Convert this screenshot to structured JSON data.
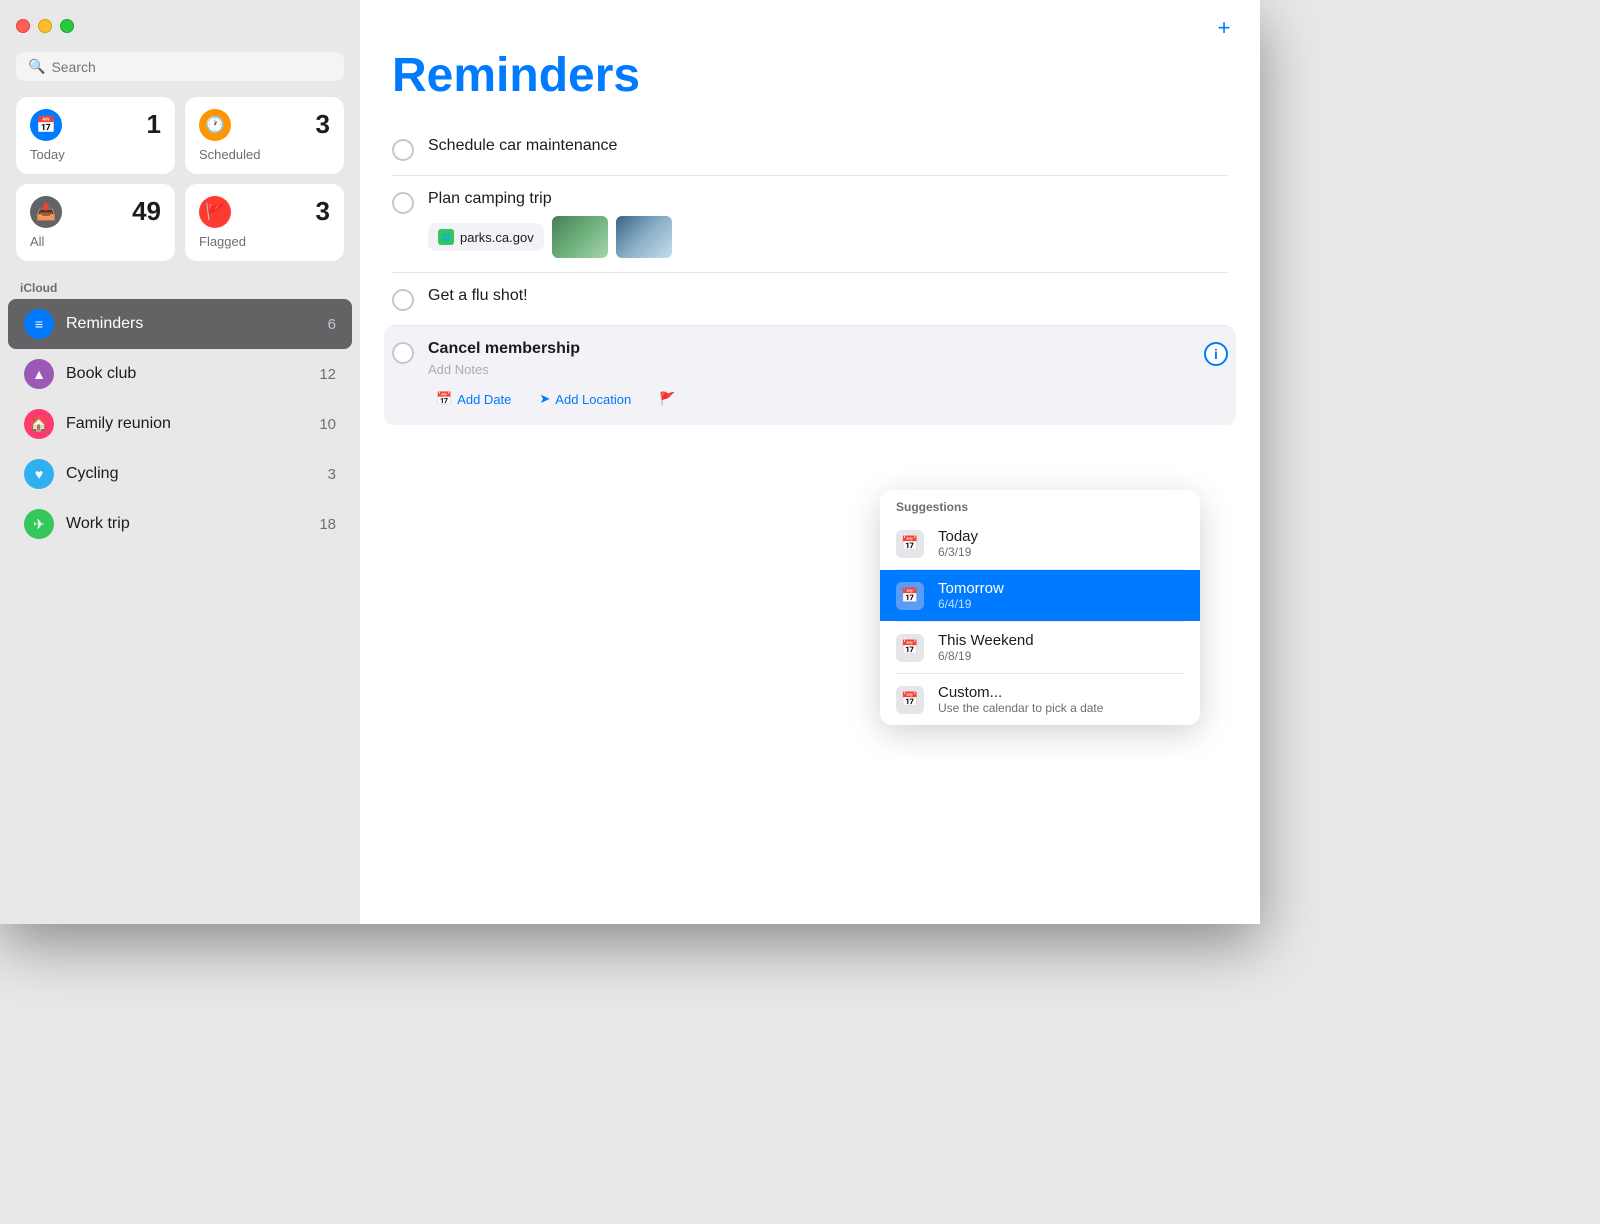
{
  "titlebar": {
    "traffic_lights": [
      "red",
      "yellow",
      "green"
    ]
  },
  "search": {
    "placeholder": "Search"
  },
  "smart_lists": [
    {
      "id": "today",
      "label": "Today",
      "count": "1",
      "icon_color": "#007aff",
      "icon": "📅"
    },
    {
      "id": "scheduled",
      "label": "Scheduled",
      "count": "3",
      "icon_color": "#ff9500",
      "icon": "🕐"
    },
    {
      "id": "all",
      "label": "All",
      "count": "49",
      "icon_color": "#636366",
      "icon": "📥"
    },
    {
      "id": "flagged",
      "label": "Flagged",
      "count": "3",
      "icon_color": "#ff3b30",
      "icon": "🚩"
    }
  ],
  "icloud_label": "iCloud",
  "lists": [
    {
      "id": "reminders",
      "name": "Reminders",
      "count": "6",
      "icon_color": "#007aff",
      "active": true
    },
    {
      "id": "book-club",
      "name": "Book club",
      "count": "12",
      "icon_color": "#9b59b6"
    },
    {
      "id": "family-reunion",
      "name": "Family reunion",
      "count": "10",
      "icon_color": "#ff3b6e"
    },
    {
      "id": "cycling",
      "name": "Cycling",
      "count": "3",
      "icon_color": "#30b0f0"
    },
    {
      "id": "work-trip",
      "name": "Work trip",
      "count": "18",
      "icon_color": "#34c759"
    }
  ],
  "main": {
    "title": "Reminders",
    "add_button": "+",
    "reminders": [
      {
        "id": "car",
        "title": "Schedule car maintenance",
        "bold": false
      },
      {
        "id": "camping",
        "title": "Plan camping trip",
        "bold": false,
        "link": "parks.ca.gov",
        "has_images": true
      },
      {
        "id": "flu",
        "title": "Get a flu shot!",
        "bold": false
      },
      {
        "id": "membership",
        "title": "Cancel membership",
        "bold": true,
        "active": true,
        "add_notes_placeholder": "Add Notes",
        "add_date_label": "Add Date",
        "add_location_label": "Add Location"
      }
    ]
  },
  "suggestions_dropdown": {
    "header": "Suggestions",
    "items": [
      {
        "id": "today",
        "name": "Today",
        "date": "6/3/19",
        "selected": false
      },
      {
        "id": "tomorrow",
        "name": "Tomorrow",
        "date": "6/4/19",
        "selected": true
      },
      {
        "id": "this-weekend",
        "name": "This Weekend",
        "date": "6/8/19",
        "selected": false
      },
      {
        "id": "custom",
        "name": "Custom...",
        "date": "Use the calendar to pick a date",
        "selected": false
      }
    ]
  }
}
